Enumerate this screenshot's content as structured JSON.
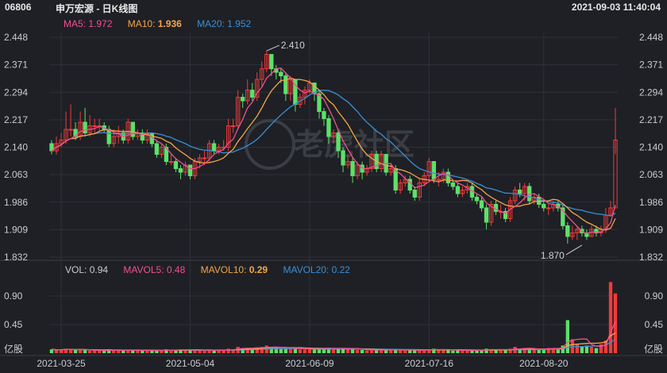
{
  "header": {
    "code": "06806",
    "name": "申万宏源 - 日K线图",
    "datetime": "2021-09-03 11:40:04"
  },
  "colors": {
    "up": "#f23a3a",
    "down": "#5ee06a",
    "ma5": "#f2508f",
    "ma10": "#f5a54a",
    "ma20": "#3a8fd6",
    "grid": "#2e3138",
    "watermark": "#3a3d44"
  },
  "ma_legend": {
    "ma5_label": "MA5:",
    "ma5_value": "1.972",
    "ma10_label": "MA10:",
    "ma10_value": "1.936",
    "ma20_label": "MA20:",
    "ma20_value": "1.952"
  },
  "vol_legend": {
    "vol_label": "VOL:",
    "vol_value": "0.94",
    "mavol5_label": "MAVOL5:",
    "mavol5_value": "0.48",
    "mavol10_label": "MAVOL10:",
    "mavol10_value": "0.29",
    "mavol20_label": "MAVOL20:",
    "mavol20_value": "0.22"
  },
  "watermark": "老虎社区",
  "chart_data": [
    {
      "type": "candlestick",
      "title": "申万宏源 - 日K线图",
      "price_ticks": [
        "2.448",
        "2.371",
        "2.294",
        "2.217",
        "2.140",
        "2.063",
        "1.986",
        "1.909",
        "1.832"
      ],
      "ylim": [
        1.832,
        2.448
      ],
      "annotations": [
        {
          "text": "2.410",
          "x": "2021-05-27",
          "y": 2.41
        },
        {
          "text": "1.870",
          "x": "2021-08-19",
          "y": 1.87
        }
      ],
      "x_ticks": [
        "2021-03-25",
        "2021-05-04",
        "2021-06-09",
        "2021-07-16",
        "2021-08-20"
      ],
      "x_tick_index": [
        2,
        29,
        54,
        79,
        103
      ],
      "close": [
        2.13,
        2.15,
        2.16,
        2.19,
        2.19,
        2.17,
        2.21,
        2.18,
        2.2,
        2.2,
        2.2,
        2.19,
        2.15,
        2.17,
        2.18,
        2.16,
        2.21,
        2.17,
        2.18,
        2.16,
        2.18,
        2.15,
        2.12,
        2.14,
        2.1,
        2.1,
        2.08,
        2.07,
        2.09,
        2.06,
        2.1,
        2.11,
        2.11,
        2.15,
        2.13,
        2.14,
        2.14,
        2.2,
        2.2,
        2.28,
        2.27,
        2.3,
        2.28,
        2.33,
        2.36,
        2.4,
        2.36,
        2.35,
        2.34,
        2.29,
        2.33,
        2.26,
        2.28,
        2.3,
        2.32,
        2.29,
        2.24,
        2.22,
        2.17,
        2.18,
        2.13,
        2.09,
        2.1,
        2.06,
        2.09,
        2.07,
        2.08,
        2.12,
        2.08,
        2.12,
        2.07,
        2.08,
        2.02,
        2.04,
        2.05,
        2.02,
        2.0,
        2.04,
        2.06,
        2.1,
        2.05,
        2.05,
        2.07,
        2.04,
        2.03,
        2.01,
        2.02,
        2.03,
        2.0,
        1.99,
        1.97,
        1.93,
        1.98,
        1.96,
        1.96,
        1.94,
        1.99,
        2.02,
        2.01,
        2.03,
        1.99,
        2.0,
        1.98,
        1.97,
        1.97,
        1.98,
        1.97,
        1.92,
        1.89,
        1.9,
        1.91,
        1.9,
        1.89,
        1.91,
        1.9,
        1.91,
        1.95,
        1.97,
        2.16
      ],
      "open": [
        2.15,
        2.13,
        2.15,
        2.16,
        2.19,
        2.19,
        2.17,
        2.21,
        2.18,
        2.2,
        2.2,
        2.2,
        2.19,
        2.15,
        2.17,
        2.18,
        2.16,
        2.21,
        2.17,
        2.18,
        2.16,
        2.18,
        2.15,
        2.12,
        2.14,
        2.1,
        2.1,
        2.08,
        2.07,
        2.09,
        2.06,
        2.1,
        2.11,
        2.11,
        2.15,
        2.13,
        2.14,
        2.14,
        2.2,
        2.2,
        2.28,
        2.27,
        2.3,
        2.28,
        2.33,
        2.36,
        2.4,
        2.36,
        2.35,
        2.34,
        2.29,
        2.33,
        2.26,
        2.28,
        2.3,
        2.32,
        2.29,
        2.24,
        2.22,
        2.17,
        2.18,
        2.13,
        2.09,
        2.1,
        2.06,
        2.09,
        2.07,
        2.08,
        2.12,
        2.08,
        2.12,
        2.07,
        2.08,
        2.02,
        2.04,
        2.05,
        2.02,
        2.0,
        2.04,
        2.06,
        2.1,
        2.05,
        2.05,
        2.07,
        2.04,
        2.03,
        2.01,
        2.02,
        2.03,
        2.0,
        1.99,
        1.97,
        1.93,
        1.98,
        1.96,
        1.96,
        1.94,
        1.99,
        2.02,
        2.01,
        2.03,
        1.99,
        2.0,
        1.98,
        1.97,
        1.97,
        1.98,
        1.97,
        1.92,
        1.89,
        1.9,
        1.91,
        1.9,
        1.89,
        1.91,
        1.9,
        1.91,
        1.95,
        1.97
      ],
      "high": [
        2.16,
        2.17,
        2.18,
        2.24,
        2.26,
        2.21,
        2.24,
        2.25,
        2.23,
        2.22,
        2.22,
        2.21,
        2.2,
        2.19,
        2.2,
        2.19,
        2.22,
        2.21,
        2.19,
        2.19,
        2.19,
        2.18,
        2.16,
        2.15,
        2.15,
        2.12,
        2.11,
        2.09,
        2.1,
        2.09,
        2.11,
        2.12,
        2.13,
        2.16,
        2.16,
        2.15,
        2.16,
        2.22,
        2.22,
        2.3,
        2.29,
        2.33,
        2.32,
        2.35,
        2.38,
        2.41,
        2.39,
        2.37,
        2.36,
        2.35,
        2.34,
        2.33,
        2.29,
        2.31,
        2.33,
        2.32,
        2.3,
        2.25,
        2.23,
        2.19,
        2.19,
        2.14,
        2.12,
        2.11,
        2.1,
        2.1,
        2.09,
        2.13,
        2.13,
        2.13,
        2.12,
        2.09,
        2.09,
        2.05,
        2.06,
        2.06,
        2.03,
        2.05,
        2.07,
        2.11,
        2.1,
        2.07,
        2.08,
        2.08,
        2.05,
        2.04,
        2.03,
        2.04,
        2.04,
        2.01,
        2.0,
        1.98,
        1.99,
        1.99,
        1.98,
        1.97,
        2.0,
        2.03,
        2.04,
        2.04,
        2.04,
        2.01,
        2.01,
        1.99,
        1.98,
        1.99,
        1.99,
        1.98,
        1.93,
        1.92,
        1.92,
        1.92,
        1.91,
        1.92,
        1.92,
        1.92,
        1.97,
        1.99,
        2.25
      ],
      "low": [
        2.12,
        2.12,
        2.14,
        2.15,
        2.17,
        2.16,
        2.16,
        2.17,
        2.17,
        2.18,
        2.18,
        2.18,
        2.14,
        2.14,
        2.15,
        2.15,
        2.15,
        2.16,
        2.16,
        2.15,
        2.15,
        2.14,
        2.11,
        2.11,
        2.09,
        2.09,
        2.07,
        2.05,
        2.06,
        2.05,
        2.05,
        2.08,
        2.09,
        2.1,
        2.12,
        2.12,
        2.13,
        2.13,
        2.18,
        2.19,
        2.25,
        2.26,
        2.27,
        2.27,
        2.31,
        2.35,
        2.34,
        2.33,
        2.32,
        2.27,
        2.27,
        2.24,
        2.25,
        2.26,
        2.29,
        2.27,
        2.22,
        2.2,
        2.15,
        2.15,
        2.11,
        2.07,
        2.08,
        2.04,
        2.05,
        2.05,
        2.06,
        2.07,
        2.07,
        2.07,
        2.06,
        2.06,
        2.01,
        2.01,
        2.03,
        2.01,
        1.99,
        1.99,
        2.03,
        2.05,
        2.04,
        2.03,
        2.04,
        2.03,
        2.02,
        2.0,
        2.0,
        2.01,
        1.99,
        1.98,
        1.96,
        1.91,
        1.92,
        1.95,
        1.94,
        1.93,
        1.93,
        1.98,
        2.0,
        1.99,
        1.98,
        1.98,
        1.97,
        1.96,
        1.95,
        1.96,
        1.96,
        1.91,
        1.87,
        1.88,
        1.88,
        1.89,
        1.88,
        1.89,
        1.89,
        1.89,
        1.9,
        1.95,
        2.12
      ],
      "ma5_last": 1.972,
      "ma10_last": 1.936,
      "ma20_last": 1.952
    },
    {
      "type": "bar",
      "title": "VOL",
      "unit": "亿股",
      "vol_ticks": [
        "0.90",
        "0.45"
      ],
      "ylim": [
        0,
        1.15
      ],
      "volume": [
        0.06,
        0.05,
        0.05,
        0.07,
        0.06,
        0.05,
        0.06,
        0.05,
        0.04,
        0.04,
        0.04,
        0.04,
        0.06,
        0.05,
        0.04,
        0.04,
        0.05,
        0.05,
        0.04,
        0.04,
        0.04,
        0.04,
        0.05,
        0.04,
        0.06,
        0.04,
        0.05,
        0.06,
        0.05,
        0.06,
        0.05,
        0.05,
        0.04,
        0.05,
        0.04,
        0.04,
        0.05,
        0.07,
        0.06,
        0.1,
        0.08,
        0.08,
        0.07,
        0.09,
        0.1,
        0.12,
        0.09,
        0.08,
        0.07,
        0.09,
        0.08,
        0.07,
        0.06,
        0.06,
        0.06,
        0.06,
        0.07,
        0.06,
        0.08,
        0.06,
        0.07,
        0.08,
        0.06,
        0.07,
        0.05,
        0.05,
        0.04,
        0.06,
        0.05,
        0.05,
        0.05,
        0.05,
        0.06,
        0.05,
        0.04,
        0.05,
        0.05,
        0.05,
        0.05,
        0.06,
        0.07,
        0.05,
        0.05,
        0.05,
        0.04,
        0.05,
        0.04,
        0.04,
        0.05,
        0.05,
        0.05,
        0.07,
        0.06,
        0.05,
        0.05,
        0.05,
        0.07,
        0.1,
        0.06,
        0.08,
        0.07,
        0.05,
        0.06,
        0.07,
        0.08,
        0.07,
        0.08,
        0.12,
        0.52,
        0.22,
        0.15,
        0.1,
        0.12,
        0.1,
        0.08,
        0.14,
        0.2,
        1.12,
        0.94
      ],
      "mavol5_last": 0.48,
      "mavol10_last": 0.29,
      "mavol20_last": 0.22
    }
  ]
}
